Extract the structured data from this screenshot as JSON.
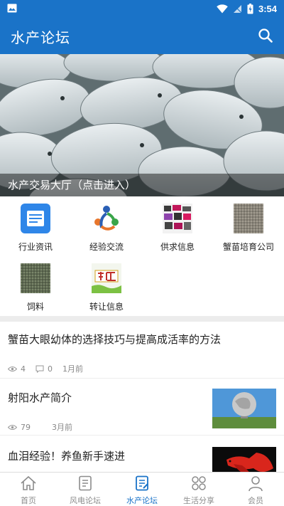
{
  "status_bar": {
    "time": "3:54"
  },
  "app_bar": {
    "title": "水产论坛"
  },
  "banner": {
    "caption": "水产交易大厅（点击进入）"
  },
  "categories": [
    {
      "label": "行业资讯",
      "icon": "news-icon"
    },
    {
      "label": "经验交流",
      "icon": "community-icon"
    },
    {
      "label": "供求信息",
      "icon": "supply-demand-icon"
    },
    {
      "label": "蟹苗培育公司",
      "icon": "crab-seedling-icon"
    },
    {
      "label": "饲料",
      "icon": "feed-icon"
    },
    {
      "label": "转让信息",
      "icon": "transfer-icon"
    }
  ],
  "articles": [
    {
      "title": "蟹苗大眼幼体的选择技巧与提高成活率的方法",
      "views": "4",
      "comments": "0",
      "time": "1月前"
    },
    {
      "title": "射阳水产简介",
      "views": "79",
      "time": "3月前"
    },
    {
      "title": "血泪经验！养鱼新手速进"
    }
  ],
  "bottom_nav": [
    {
      "label": "首页"
    },
    {
      "label": "风电论坛"
    },
    {
      "label": "水产论坛"
    },
    {
      "label": "生活分享"
    },
    {
      "label": "会员"
    }
  ],
  "colors": {
    "primary": "#1a73c8",
    "inactive": "#8c8c8c"
  }
}
